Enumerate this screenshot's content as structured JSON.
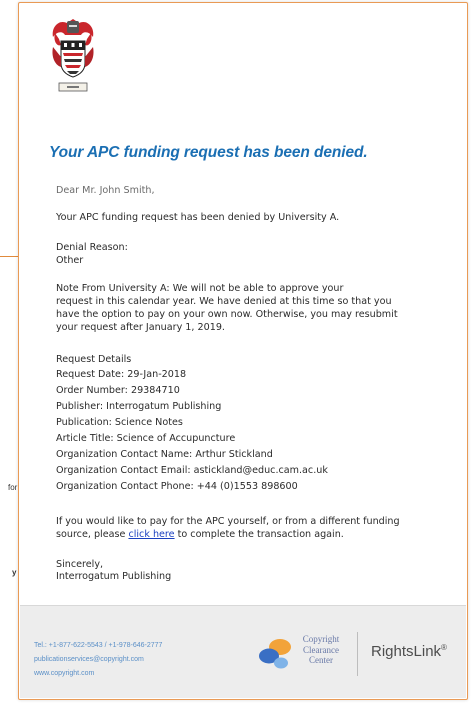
{
  "background_fragments": {
    "frag_for": "for",
    "frag_y": "y"
  },
  "email": {
    "headline": "Your APC funding request has been denied.",
    "greeting": "Dear Mr. John Smith,",
    "intro": "Your APC funding request has been denied by University A.",
    "denial_reason_label": "Denial Reason:",
    "denial_reason_value": "Other",
    "note_lines": [
      "Note From University A: We will not be able to approve your",
      "request in this calendar year. We have denied at this time so that you",
      "have the option to pay on your own now. Otherwise, you may resubmit",
      "your request after January 1, 2019."
    ],
    "details_heading": "Request Details",
    "details": [
      "Request Date:  29-Jan-2018",
      "Order Number:  29384710",
      "Publisher:  Interrogatum Publishing",
      "Publication:  Science Notes",
      "Article Title:  Science of Accupuncture",
      "Organization Contact Name:  Arthur Stickland",
      "Organization Contact Email:  astickland@educ.cam.ac.uk",
      "Organization Contact Phone:  +44 (0)1553 898600"
    ],
    "pay_line1": "If you would like to pay for the APC yourself, or from a different funding",
    "pay_line2_pre": "source, please ",
    "pay_link": "click here",
    "pay_line2_post": "  to complete the transaction again.",
    "signoff": "Sincerely,",
    "signature": "Interrogatum Publishing"
  },
  "footer": {
    "phones": "Tel.: +1-877-622-5543 / +1-978-646-2777",
    "email": "publicationservices@copyright.com",
    "website": "www.copyright.com",
    "ccc_line1": "Copyright",
    "ccc_line2": "Clearance",
    "ccc_line3": "Center",
    "rightslink": "RightsLink",
    "rightslink_mark": "®"
  },
  "colors": {
    "headline": "#1b6fb3",
    "panel_border": "#e99a55",
    "link": "#1a3fbf",
    "footer_bg": "#ededed"
  }
}
